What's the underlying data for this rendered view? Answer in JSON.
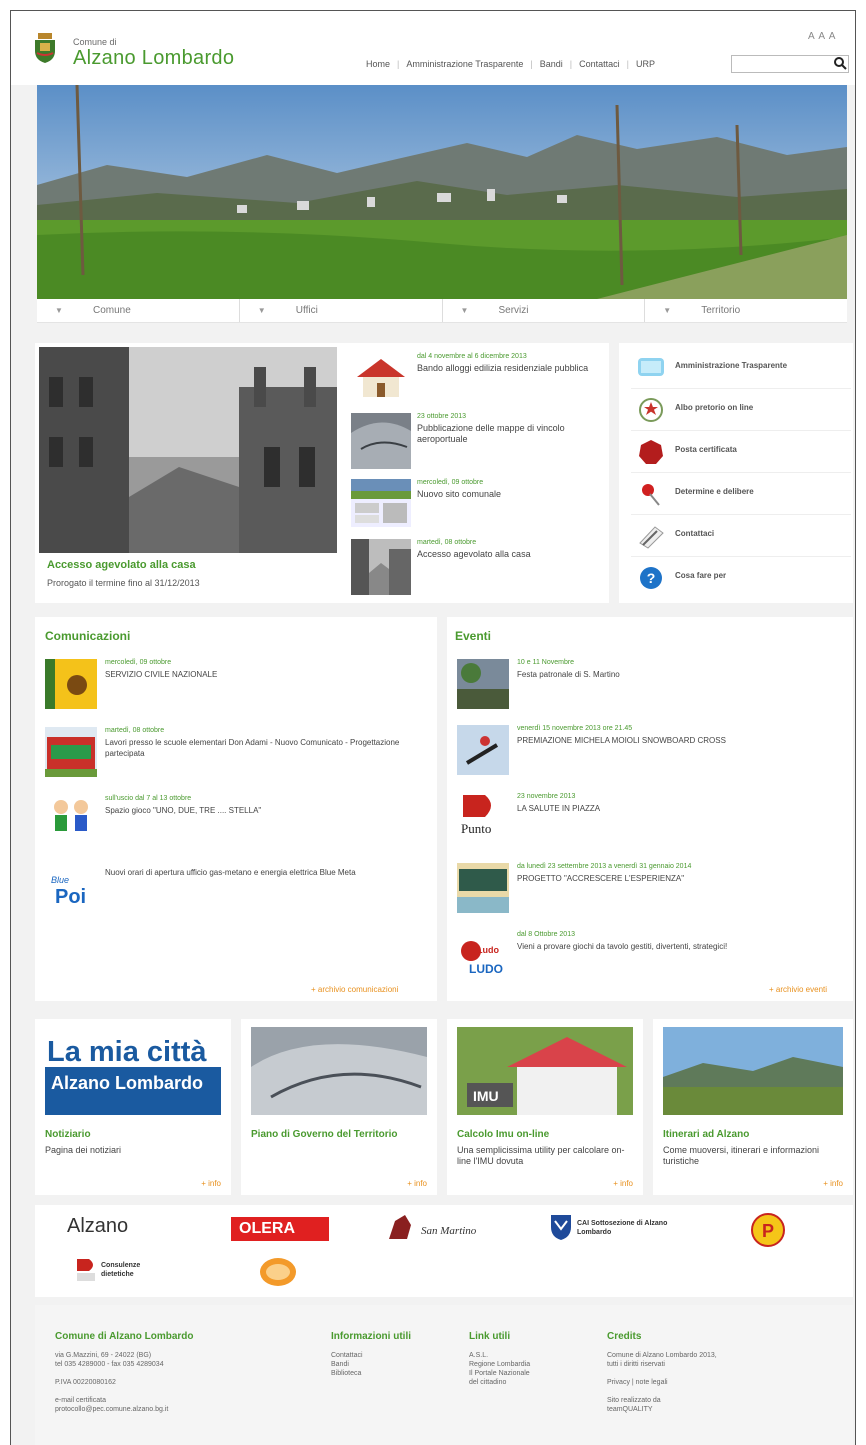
{
  "header": {
    "logo_small": "Comune di",
    "logo_big": "Alzano Lombardo",
    "text_size": "A A A",
    "nav": [
      "Home",
      "Amministrazione Trasparente",
      "Bandi",
      "Contattaci",
      "URP"
    ],
    "search_placeholder": ""
  },
  "main_nav": [
    "Comune",
    "Uffici",
    "Servizi",
    "Territorio"
  ],
  "featured": {
    "title": "Accesso agevolato alla casa",
    "subtitle": "Prorogato il termine fino al 31/12/2013"
  },
  "news": [
    {
      "date": "dal 4 novembre al 6 dicembre 2013",
      "title": "Bando alloggi edilizia residenziale pubblica"
    },
    {
      "date": "23 ottobre 2013",
      "title": "Pubblicazione delle mappe di vincolo aeroportuale"
    },
    {
      "date": "mercoledì, 09 ottobre",
      "title": "Nuovo sito comunale"
    },
    {
      "date": "martedì, 08 ottobre",
      "title": "Accesso agevolato alla casa"
    }
  ],
  "quick_links": [
    "Amministrazione Trasparente",
    "Albo pretorio on line",
    "Posta certificata",
    "Determine e delibere",
    "Contattaci",
    "Cosa fare per"
  ],
  "comunicazioni": {
    "title": "Comunicazioni",
    "items": [
      {
        "date": "mercoledì, 09 ottobre",
        "title": "SERVIZIO CIVILE NAZIONALE"
      },
      {
        "date": "martedì, 08 ottobre",
        "title": "Lavori presso le scuole elementari Don Adami - Nuovo Comunicato - Progettazione partecipata"
      },
      {
        "date": "sull'uscio dal 7 al 13 ottobre",
        "title": "Spazio gioco \"UNO, DUE, TRE .... STELLA\""
      },
      {
        "date": "",
        "title": "Nuovi orari di apertura ufficio gas-metano e energia elettrica Blue Meta"
      }
    ],
    "more": "+ archivio comunicazioni"
  },
  "eventi": {
    "title": "Eventi",
    "items": [
      {
        "date": "10 e 11 Novembre",
        "title": "Festa patronale di S. Martino"
      },
      {
        "date": "venerdì 15 novembre 2013 ore 21.45",
        "title": "PREMIAZIONE MICHELA MOIOLI SNOWBOARD CROSS"
      },
      {
        "date": "23 novembre 2013",
        "title": "LA SALUTE IN PIAZZA"
      },
      {
        "date": "da lunedì 23 settembre 2013 a venerdì 31 gennaio 2014",
        "title": "PROGETTO \"ACCRESCERE L'ESPERIENZA\""
      },
      {
        "date": "dal 8 Ottobre 2013",
        "title": "Vieni a provare giochi da tavolo gestiti, divertenti, strategici!"
      }
    ],
    "more": "+ archivio eventi"
  },
  "promos": [
    {
      "title": "Notiziario",
      "sub": "Pagina dei notiziari",
      "img_line1": "La mia città",
      "img_line2": "Alzano Lombardo"
    },
    {
      "title": "Piano di Governo del Territorio",
      "sub": ""
    },
    {
      "title": "Calcolo Imu on-line",
      "sub": "Una semplicissima utility per calcolare on-line l'IMU dovuta",
      "img_label": "IMU"
    },
    {
      "title": "Itinerari ad Alzano",
      "sub": "Come muoversi, itinerari e informazioni turistiche"
    }
  ],
  "promo_more": "+ info",
  "sponsors": {
    "alzano": "Alzano",
    "olera": "OLERA",
    "san_martino": "San Martino",
    "cai": "CAI Sottosezione di Alzano Lombardo",
    "consulenze": "Consulenze dietetiche"
  },
  "footer": {
    "col1_title": "Comune di Alzano Lombardo",
    "col1_lines": [
      "via G.Mazzini, 69 - 24022 (BG)",
      "tel 035 4289000 - fax 035 4289034",
      "",
      "P.IVA 00220080162",
      "",
      "e-mail certificata",
      "protocollo@pec.comune.alzano.bg.it"
    ],
    "col2_title": "Informazioni utili",
    "col2_lines": [
      "Contattaci",
      "Bandi",
      "Biblioteca"
    ],
    "col3_title": "Link utili",
    "col3_lines": [
      "A.S.L.",
      "Regione Lombardia",
      "Il Portale Nazionale",
      "del cittadino"
    ],
    "col4_title": "Credits",
    "col4_lines": [
      "Comune di Alzano Lombardo 2013,",
      "tutti i diritti riservati",
      "",
      "Privacy | note legali",
      "",
      "Sito realizzato da",
      "teamQUALITY"
    ]
  }
}
